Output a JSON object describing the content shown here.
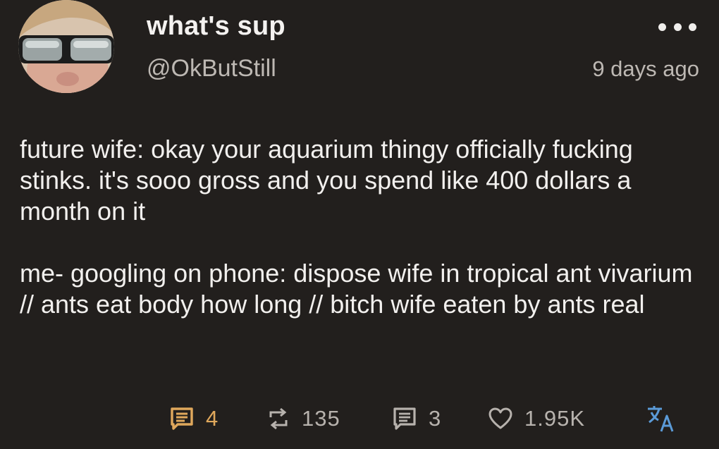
{
  "author": {
    "display_name": "what's sup",
    "handle": "@OkButStill",
    "avatar_icon": "avatar-photo-sunglasses"
  },
  "post": {
    "timestamp": "9 days ago",
    "paragraphs": [
      "future wife: okay your aquarium thingy officially fucking stinks. it's sooo gross and you spend like 400 dollars a month on it",
      "me- googling on phone: dispose wife in tropical ant vivarium // ants eat body how long // bitch wife eaten by ants real"
    ]
  },
  "actions": {
    "replies": {
      "icon": "comment-icon",
      "count": "4"
    },
    "reblogs": {
      "icon": "repost-icon",
      "count": "135"
    },
    "quotes": {
      "icon": "quote-icon",
      "count": "3"
    },
    "likes": {
      "icon": "heart-icon",
      "count": "1.95K"
    },
    "translate": {
      "icon": "translate-icon"
    }
  },
  "colors": {
    "background": "#221f1d",
    "text": "#f2f0ee",
    "muted": "#b7b2ad",
    "accent": "#e0a85c",
    "translate": "#5b9bd8"
  }
}
